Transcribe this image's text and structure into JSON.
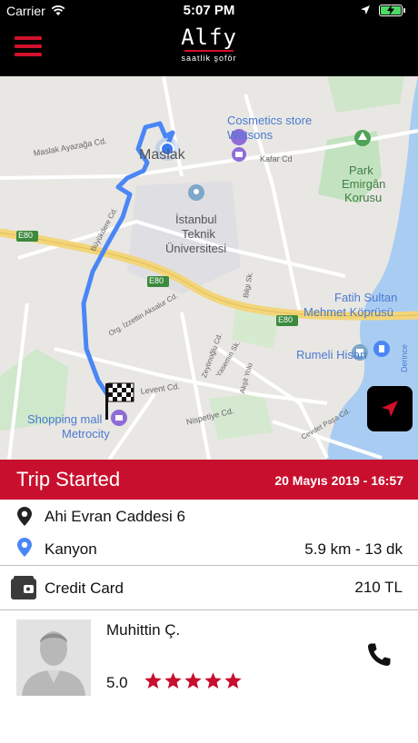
{
  "status_bar": {
    "carrier": "Carrier",
    "time": "5:07 PM"
  },
  "header": {
    "brand_name": "Alfy",
    "brand_tagline": "saatlik şoför"
  },
  "map": {
    "labels": {
      "maslak": "Maslak",
      "maslak_ayazaga": "Maslak Ayazağa Cd.",
      "cosmetics_store": "Cosmetics store",
      "watsons": "Watsons",
      "kafar_cd": "Kafar Cd",
      "park": "Park",
      "emirgan_korusu_1": "Emirgân",
      "emirgan_korusu_2": "Korusu",
      "itu_1": "İstanbul",
      "itu_2": "Teknik",
      "itu_3": "Üniversitesi",
      "e80_1": "E80",
      "e80_2": "E80",
      "e80_3": "E80",
      "buyukdere": "Büyükdere Cd.",
      "izzettin": "Org. İzzettin Aksalur Cd.",
      "bilgi_sk": "Bilgi Sk.",
      "fatih_sultan_1": "Fatih Sultan",
      "fatih_sultan_2": "Mehmet Köprüsü",
      "zeytinoglu": "Zeytinoğlu Cd.",
      "yasemin": "Yasemin Sk.",
      "aksit": "Akşit Yolu",
      "rumeli_hisari": "Rumeli Hisarı",
      "derince": "Derince",
      "shopping_mall": "Shopping mall",
      "metrocity": "Metrocity",
      "levent_cd": "Levent Cd.",
      "nispetiye": "Nispetiye Cd.",
      "cevdet_pasa": "Cevdet Paşa Cd."
    }
  },
  "trip": {
    "status": "Trip Started",
    "datetime": "20 Mayıs 2019 - 16:57",
    "pickup": "Ahi Evran Caddesi 6",
    "destination": "Kanyon",
    "distance_duration": "5.9 km - 13 dk",
    "payment_method": "Credit Card",
    "price": "210 TL"
  },
  "driver": {
    "name": "Muhittin Ç.",
    "rating": "5.0",
    "rating_stars": 5
  },
  "colors": {
    "accent": "#c8102e",
    "route": "#4a86f5",
    "header": "#000000"
  },
  "icons": {
    "menu": "hamburger-menu-icon",
    "wifi": "wifi-icon",
    "battery": "battery-icon",
    "pickup_pin": "map-pin-icon",
    "destination_pin": "map-pin-icon",
    "payment": "wallet-icon",
    "call": "phone-icon",
    "locate": "navigation-arrow-icon",
    "finish": "checkered-flag-icon"
  }
}
